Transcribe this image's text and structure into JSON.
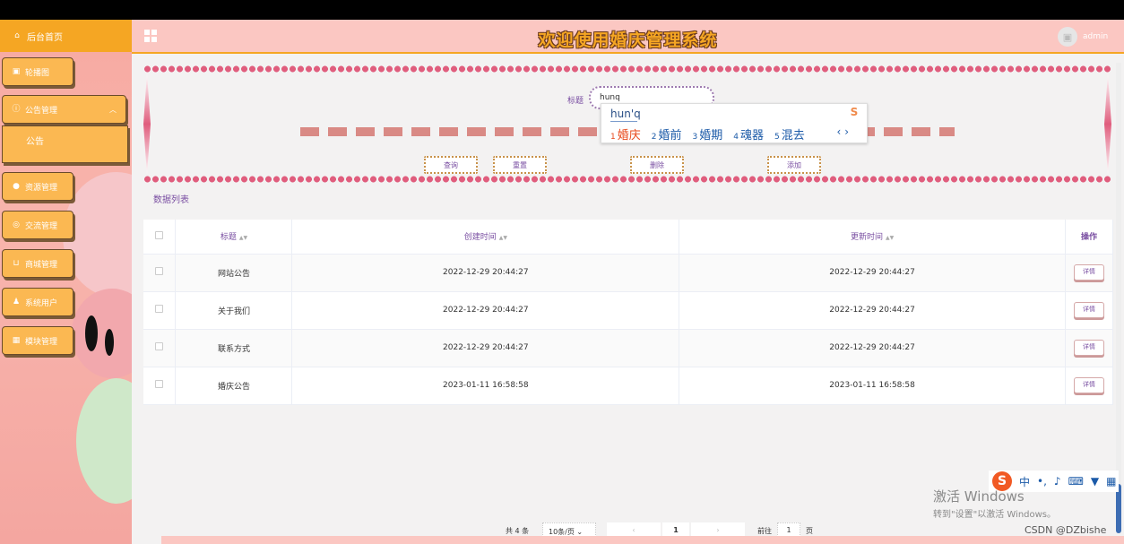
{
  "header": {
    "title": "欢迎使用婚庆管理系统",
    "username": "admin"
  },
  "sidebar": {
    "home": "后台首页",
    "items": [
      {
        "label": "轮播图"
      },
      {
        "label": "公告管理",
        "sub": [
          "公告"
        ]
      },
      {
        "label": "资源管理"
      },
      {
        "label": "交流管理"
      },
      {
        "label": "商城管理"
      },
      {
        "label": "系统用户"
      },
      {
        "label": "模块管理"
      }
    ]
  },
  "search": {
    "label": "标题",
    "value": "hunq"
  },
  "ime": {
    "pinyin": "hun'q",
    "candidates": [
      {
        "num": "1",
        "text": "婚庆"
      },
      {
        "num": "2",
        "text": "婚前"
      },
      {
        "num": "3",
        "text": "婚期"
      },
      {
        "num": "4",
        "text": "魂器"
      },
      {
        "num": "5",
        "text": "混去"
      }
    ]
  },
  "buttons": {
    "query": "查询",
    "reset": "重置",
    "delete": "删除",
    "add": "添加"
  },
  "list_title": "数据列表",
  "table": {
    "headers": [
      "标题",
      "创建时间",
      "更新时间",
      "操作"
    ],
    "action_label": "详情",
    "rows": [
      [
        "网站公告",
        "2022-12-29 20:44:27",
        "2022-12-29 20:44:27"
      ],
      [
        "关于我们",
        "2022-12-29 20:44:27",
        "2022-12-29 20:44:27"
      ],
      [
        "联系方式",
        "2022-12-29 20:44:27",
        "2022-12-29 20:44:27"
      ],
      [
        "婚庆公告",
        "2023-01-11 16:58:58",
        "2023-01-11 16:58:58"
      ]
    ]
  },
  "pagination": {
    "total": "共 4 条",
    "page_size": "10条/页",
    "current": "1",
    "goto_label": "前往",
    "goto_value": "1",
    "page_suffix": "页"
  },
  "overlay": {
    "activate_title": "激活 Windows",
    "activate_hint": "转到\"设置\"以激活 Windows。",
    "watermark": "CSDN @DZbishe",
    "ime_toolbar_label": "中"
  }
}
